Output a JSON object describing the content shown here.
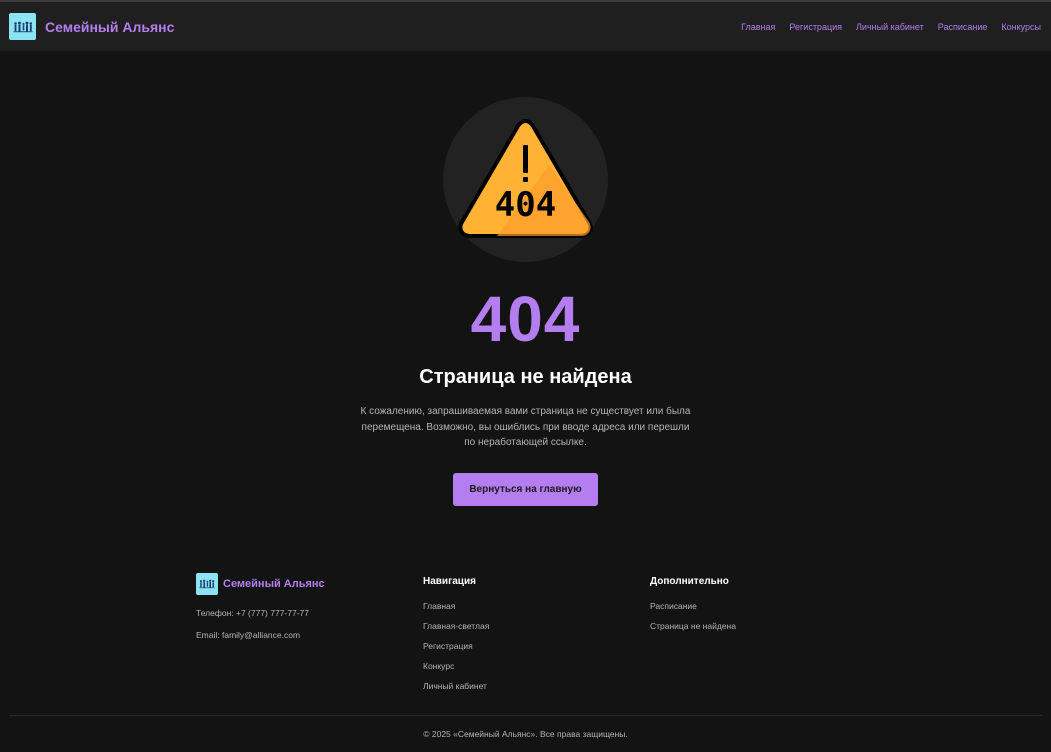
{
  "header": {
    "brand": "Семейный Альянс",
    "logo_icon": "family-icon",
    "nav": [
      "Главная",
      "Регистрация",
      "Личный кабинет",
      "Расписание",
      "Конкурсы"
    ]
  },
  "error": {
    "icon": "warning-404-icon",
    "icon_text": "404",
    "code": "404",
    "title": "Страница не найдена",
    "description": "К сожалению, запрашиваемая вами страница не существует или была перемещена. Возможно, вы ошиблись при вводе адреса или перешли по неработающей ссылке.",
    "button_label": "Вернуться на главную"
  },
  "footer": {
    "brand": "Семейный Альянс",
    "phone": "Телефон: +7 (777) 777-77-77",
    "email": "Email: family@alliance.com",
    "nav_title": "Навигация",
    "nav_links": [
      "Главная",
      "Главная-светлая",
      "Регистрация",
      "Конкурс",
      "Личный кабинет"
    ],
    "extra_title": "Дополнительно",
    "extra_links": [
      "Расписание",
      "Страница не найдена"
    ],
    "copyright": "© 2025 «Семейный Альянс». Все права защищены."
  },
  "colors": {
    "accent": "#b57ef0",
    "logo_bg": "#8be3f4",
    "background": "#131313",
    "header_bg": "#1f1f1f",
    "warning": "#ffb233"
  }
}
